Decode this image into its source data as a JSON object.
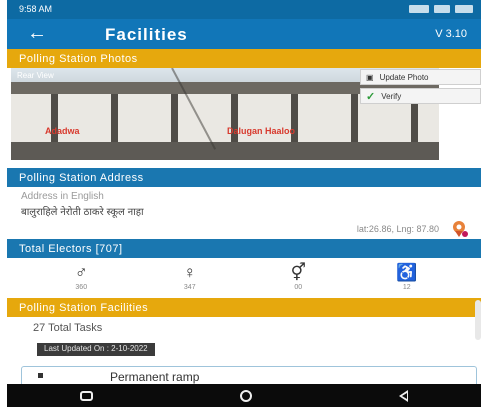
{
  "status_bar": {
    "time": "9:58 AM"
  },
  "app_bar": {
    "title": "Facilities",
    "version": "V 3.10",
    "back_glyph": "←"
  },
  "photos": {
    "header": "Polling Station Photos",
    "rear_label": "Rear View",
    "sign_left": "Adadwa",
    "sign_right": "Dalugan Haaloo",
    "update_label": "Update Photo",
    "verify_label": "Verify"
  },
  "address": {
    "header": "Polling Station Address",
    "label": "Address in English",
    "value": "बालुराहिले नेरोती ठाकरे स्कूल नाहा",
    "coords": "lat:26.86, Lng: 87.80"
  },
  "electors": {
    "header": "Total Electors [707]",
    "items": [
      {
        "icon": "male-icon",
        "glyph": "♂",
        "count": "360"
      },
      {
        "icon": "female-icon",
        "glyph": "♀",
        "count": "347"
      },
      {
        "icon": "third-gender-icon",
        "glyph": "⚥",
        "count": "00"
      },
      {
        "icon": "pwd-icon",
        "glyph": "♿",
        "count": "12"
      }
    ]
  },
  "facilities": {
    "header": "Polling Station Facilities",
    "total_tasks": "27 Total Tasks",
    "last_updated": "Last Updated On : 2-10-2022",
    "first_item": "Permanent ramp"
  },
  "colors": {
    "primary": "#1176b8",
    "accent": "#e6a80d",
    "nav": "#0b0b0b"
  }
}
